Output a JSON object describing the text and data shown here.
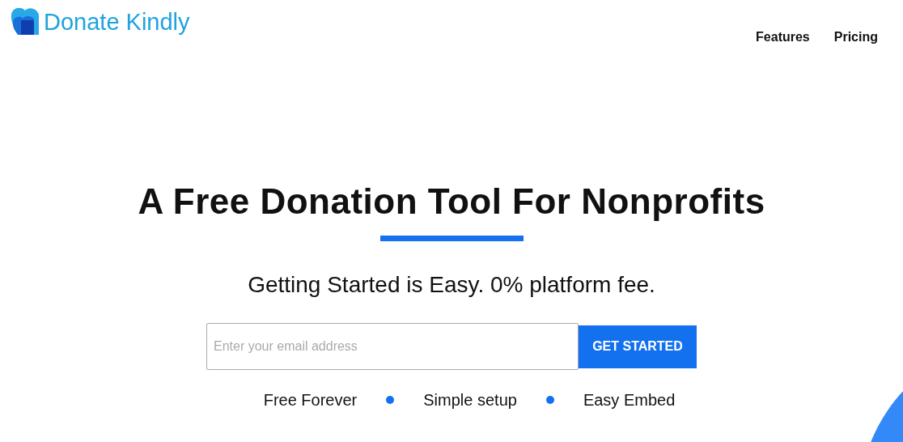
{
  "logo": {
    "text": "Donate Kindly"
  },
  "nav": [
    "Features",
    "Pricing"
  ],
  "hero": {
    "title": "A Free Donation Tool For Nonprofits",
    "subtitle": "Getting Started is Easy. 0% platform fee.",
    "email": {
      "placeholder": "Enter your email address"
    },
    "button": "GET STARTED",
    "features": [
      "Free Forever",
      "Simple setup",
      "Easy Embed"
    ]
  }
}
